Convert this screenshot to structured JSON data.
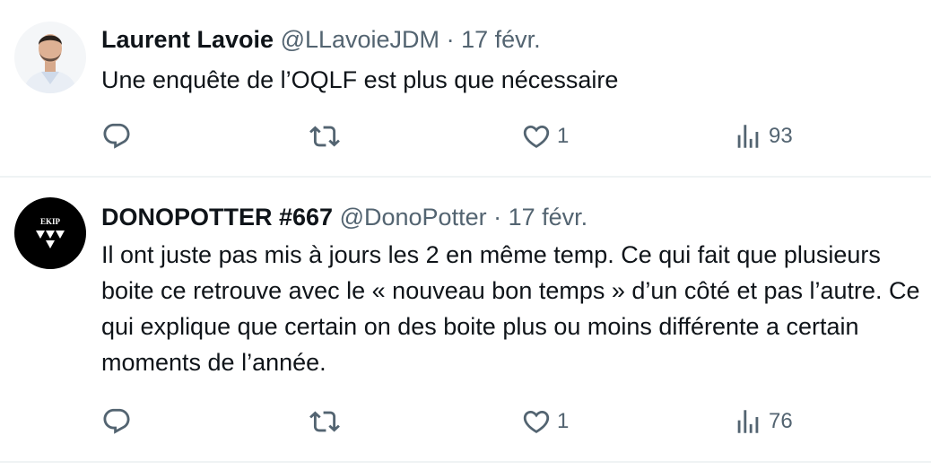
{
  "colors": {
    "text_primary": "#0f1419",
    "text_secondary": "#536471",
    "divider": "#eff3f4"
  },
  "tweets": [
    {
      "display_name": "Laurent Lavoie",
      "handle": "@LLavoieJDM",
      "separator": "·",
      "date": "17 févr.",
      "avatar_icon": "person-photo-avatar",
      "text_lines": [
        "Une enquête de l’OQLF est plus que nécessaire"
      ],
      "actions": {
        "reply_count": "",
        "retweet_count": "",
        "like_count": "1",
        "view_count": "93"
      }
    },
    {
      "display_name": "DONOPOTTER #667",
      "handle": "@DonoPotter",
      "separator": "·",
      "date": "17 févr.",
      "avatar_icon": "ekip-logo-avatar",
      "avatar_logo_text": "EKIP",
      "text_lines": [
        "Il ont juste pas mis à jours les 2 en même temp. Ce qui fait que plusieurs",
        "boite ce retrouve avec le « nouveau bon temps » d’un côté et pas l’autre. Ce",
        "qui explique que certain on des boite plus ou moins différente a certain",
        "moments de l’année."
      ],
      "actions": {
        "reply_count": "",
        "retweet_count": "",
        "like_count": "1",
        "view_count": "76"
      }
    }
  ]
}
